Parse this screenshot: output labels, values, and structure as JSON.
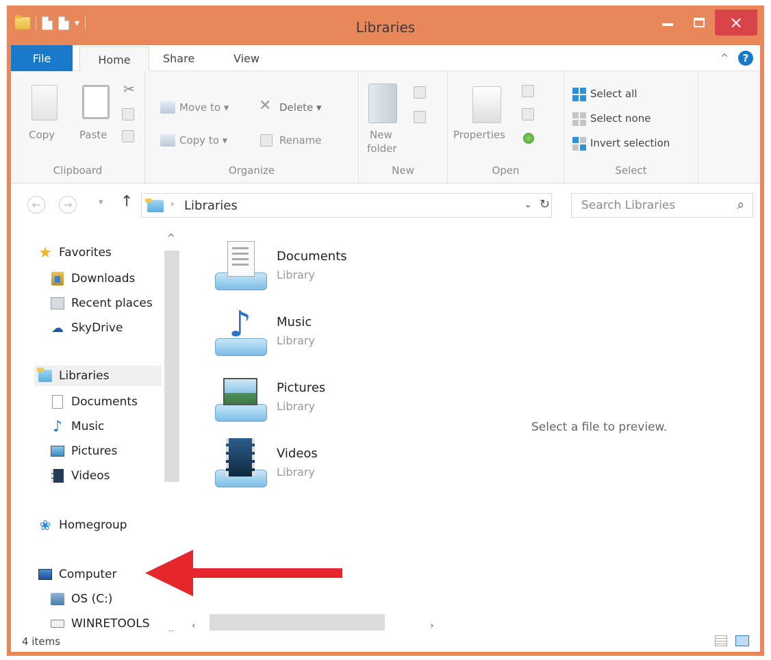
{
  "window": {
    "title": "Libraries"
  },
  "controls": {
    "close": "×"
  },
  "ribbon_tabs": [
    "File",
    "Home",
    "Share",
    "View"
  ],
  "ribbon": {
    "clipboard": {
      "copy": "Copy",
      "paste": "Paste",
      "label": "Clipboard"
    },
    "organize": {
      "move_to": "Move to ▾",
      "copy_to": "Copy to ▾",
      "delete": "Delete ▾",
      "rename": "Rename",
      "label": "Organize"
    },
    "new": {
      "new_folder_1": "New",
      "new_folder_2": "folder",
      "label": "New"
    },
    "open": {
      "properties": "Properties",
      "label": "Open"
    },
    "select": {
      "select_all": "Select all",
      "select_none": "Select none",
      "invert": "Invert selection",
      "label": "Select"
    }
  },
  "address": {
    "path": "Libraries"
  },
  "search": {
    "placeholder": "Search Libraries"
  },
  "nav_pane": {
    "favorites": "Favorites",
    "downloads": "Downloads",
    "recent": "Recent places",
    "skydrive": "SkyDrive",
    "libraries": "Libraries",
    "documents": "Documents",
    "music": "Music",
    "pictures": "Pictures",
    "videos": "Videos",
    "homegroup": "Homegroup",
    "computer": "Computer",
    "os": "OS (C:)",
    "winretools": "WINRETOOLS"
  },
  "libraries": [
    {
      "name": "Documents",
      "type": "Library"
    },
    {
      "name": "Music",
      "type": "Library"
    },
    {
      "name": "Pictures",
      "type": "Library"
    },
    {
      "name": "Videos",
      "type": "Library"
    }
  ],
  "preview_text": "Select a file to preview.",
  "status": {
    "items": "4 items"
  },
  "colors": {
    "frame": "#e8875a",
    "file_tab": "#1979ca",
    "close": "#d9434a",
    "annotation_arrow": "#e5262d"
  }
}
